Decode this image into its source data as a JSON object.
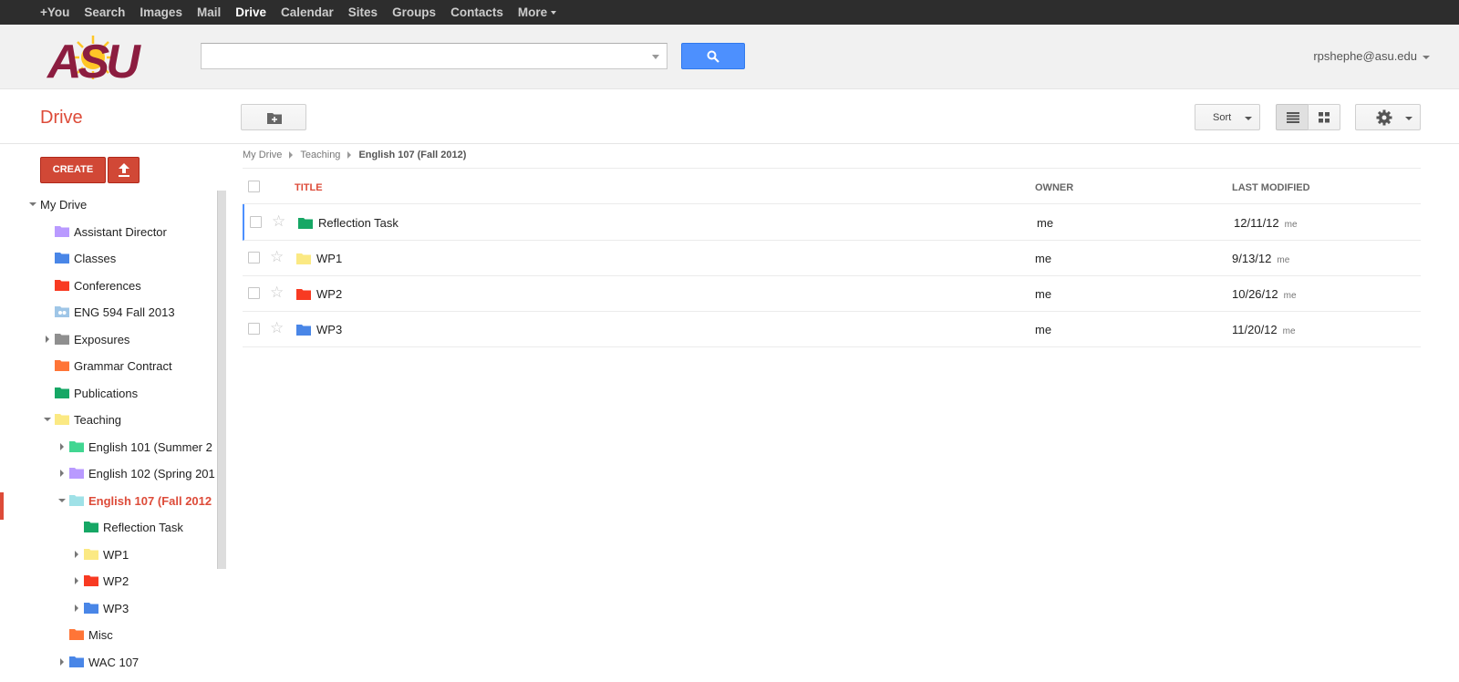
{
  "gbar": {
    "items": [
      {
        "label": "+You",
        "active": false
      },
      {
        "label": "Search",
        "active": false
      },
      {
        "label": "Images",
        "active": false
      },
      {
        "label": "Mail",
        "active": false
      },
      {
        "label": "Drive",
        "active": true
      },
      {
        "label": "Calendar",
        "active": false
      },
      {
        "label": "Sites",
        "active": false
      },
      {
        "label": "Groups",
        "active": false
      },
      {
        "label": "Contacts",
        "active": false
      },
      {
        "label": "More",
        "active": false
      }
    ]
  },
  "header": {
    "logo_text": "ASU",
    "search_value": "",
    "account": "rpshephe@asu.edu"
  },
  "toolbar": {
    "drive_title": "Drive",
    "sort_label": "Sort"
  },
  "sidebar": {
    "create_label": "CREATE",
    "tree": [
      {
        "label": "My Drive",
        "depth": 0,
        "twisty": "down",
        "color": null
      },
      {
        "label": "Assistant Director",
        "depth": 1,
        "twisty": null,
        "color": "#b99aff"
      },
      {
        "label": "Classes",
        "depth": 1,
        "twisty": null,
        "color": "#4986e7"
      },
      {
        "label": "Conferences",
        "depth": 1,
        "twisty": null,
        "color": "#f83a22"
      },
      {
        "label": "ENG 594 Fall 2013",
        "depth": 1,
        "twisty": null,
        "color": "#9fc6e7",
        "shared": true
      },
      {
        "label": "Exposures",
        "depth": 1,
        "twisty": "right",
        "color": "#8f8f8f"
      },
      {
        "label": "Grammar Contract",
        "depth": 1,
        "twisty": null,
        "color": "#ff7537"
      },
      {
        "label": "Publications",
        "depth": 1,
        "twisty": null,
        "color": "#16a765"
      },
      {
        "label": "Teaching",
        "depth": 1,
        "twisty": "down",
        "color": "#fbe983"
      },
      {
        "label": "English 101 (Summer 2",
        "depth": 2,
        "twisty": "right",
        "color": "#42d692"
      },
      {
        "label": "English 102 (Spring 201",
        "depth": 2,
        "twisty": "right",
        "color": "#b99aff"
      },
      {
        "label": "English 107 (Fall 2012",
        "depth": 2,
        "twisty": "down",
        "color": "#9fe1e7",
        "selected": true
      },
      {
        "label": "Reflection Task",
        "depth": 3,
        "twisty": null,
        "color": "#16a765"
      },
      {
        "label": "WP1",
        "depth": 3,
        "twisty": "right",
        "color": "#fbe983"
      },
      {
        "label": "WP2",
        "depth": 3,
        "twisty": "right",
        "color": "#f83a22"
      },
      {
        "label": "WP3",
        "depth": 3,
        "twisty": "right",
        "color": "#4986e7"
      },
      {
        "label": "Misc",
        "depth": 2,
        "twisty": null,
        "color": "#ff7537"
      },
      {
        "label": "WAC 107",
        "depth": 2,
        "twisty": "right",
        "color": "#4986e7"
      }
    ]
  },
  "breadcrumb": [
    "My Drive",
    "Teaching",
    "English 107 (Fall 2012)"
  ],
  "list": {
    "headers": {
      "title": "TITLE",
      "owner": "OWNER",
      "modified": "LAST MODIFIED"
    },
    "rows": [
      {
        "name": "Reflection Task",
        "owner": "me",
        "modified": "12/11/12",
        "modified_by": "me",
        "color": "#16a765"
      },
      {
        "name": "WP1",
        "owner": "me",
        "modified": "9/13/12",
        "modified_by": "me",
        "color": "#fbe983"
      },
      {
        "name": "WP2",
        "owner": "me",
        "modified": "10/26/12",
        "modified_by": "me",
        "color": "#f83a22"
      },
      {
        "name": "WP3",
        "owner": "me",
        "modified": "11/20/12",
        "modified_by": "me",
        "color": "#4986e7"
      }
    ]
  },
  "colors": {
    "accent_red": "#dd4b39",
    "search_blue": "#4d90fe",
    "asu_maroon": "#8c1d40",
    "asu_gold": "#ffc627"
  }
}
